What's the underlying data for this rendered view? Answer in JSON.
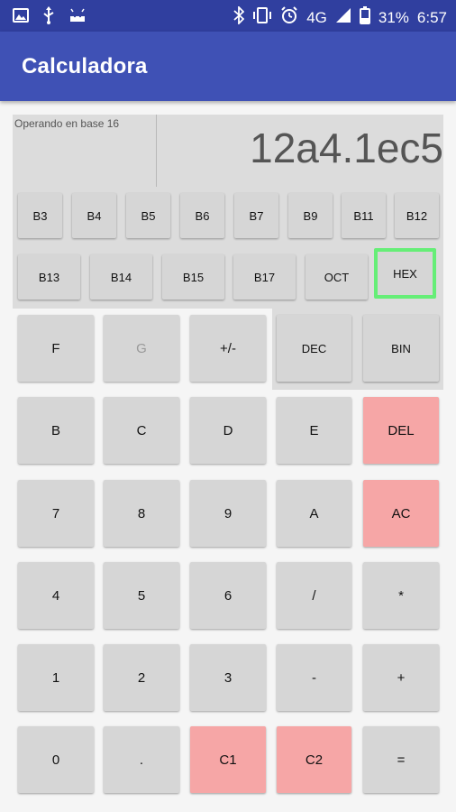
{
  "status_bar": {
    "left_icons": [
      "image-icon",
      "usb-icon",
      "android-icon"
    ],
    "right_icons": [
      "bluetooth-icon",
      "vibrate-icon",
      "alarm-icon"
    ],
    "network": "4G",
    "battery": "31%",
    "time": "6:57"
  },
  "app_bar": {
    "title": "Calculadora"
  },
  "panel": {
    "base_info": "Operando en base 16",
    "display_value": "12a4.1ec5"
  },
  "base_buttons_row1": [
    "B3",
    "B4",
    "B5",
    "B6",
    "B7",
    "B9",
    "B11",
    "B12"
  ],
  "base_buttons_row2": [
    "B13",
    "B14",
    "B15",
    "B17",
    "OCT",
    "HEX"
  ],
  "ops_buttons": [
    "DEC",
    "BIN"
  ],
  "keypad": {
    "row1": [
      "F",
      "G",
      "+/-"
    ],
    "row2": [
      "B",
      "C",
      "D",
      "E",
      "DEL"
    ],
    "row3": [
      "7",
      "8",
      "9",
      "A",
      "AC"
    ],
    "row4": [
      "4",
      "5",
      "6",
      "/",
      "*"
    ],
    "row5": [
      "1",
      "2",
      "3",
      "-",
      "+"
    ],
    "row6": [
      "0",
      ".",
      "C1",
      "C2",
      "="
    ]
  },
  "colors": {
    "status_bar": "#303f9f",
    "app_bar": "#3f51b5",
    "button": "#d6d6d6",
    "red_button": "#f6a6a6",
    "selected_highlight": "#66ee77"
  }
}
